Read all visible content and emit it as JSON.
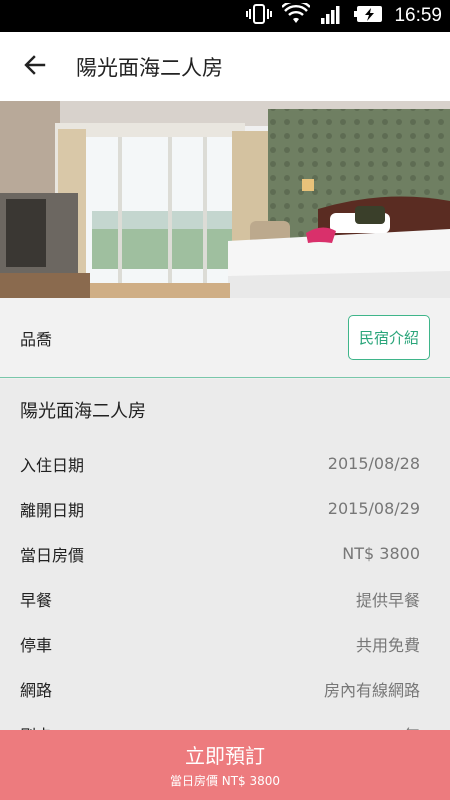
{
  "status_bar": {
    "time": "16:59"
  },
  "app_bar": {
    "title": "陽光面海二人房"
  },
  "hotel": {
    "name": "品喬",
    "bnb_button": "民宿介紹"
  },
  "room": {
    "name": "陽光面海二人房",
    "details": [
      {
        "label": "入住日期",
        "value": "2015/08/28"
      },
      {
        "label": "離開日期",
        "value": "2015/08/29"
      },
      {
        "label": "當日房價",
        "value": "NT$ 3800"
      },
      {
        "label": "早餐",
        "value": "提供早餐"
      },
      {
        "label": "停車",
        "value": "共用免費"
      },
      {
        "label": "網路",
        "value": "房內有線網路"
      },
      {
        "label": "刷卡",
        "value": "無"
      }
    ]
  },
  "bottom_bar": {
    "book_label": "立即預訂",
    "price_text": "當日房價 NT$ 3800"
  },
  "colors": {
    "accent": "#3fb58a",
    "book_bar": "#ed7b7e",
    "status_bar": "#000000"
  }
}
